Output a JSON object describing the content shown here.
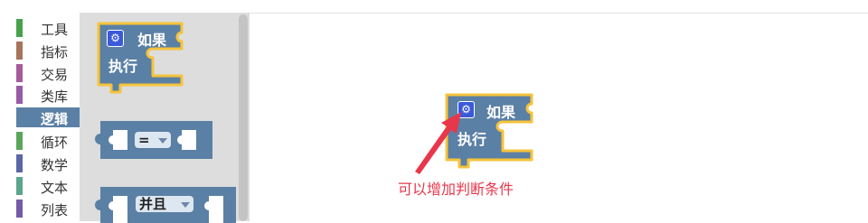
{
  "toolbox": {
    "categories": [
      {
        "label": "工具",
        "color": "#49a14b"
      },
      {
        "label": "指标",
        "color": "#a5745b"
      },
      {
        "label": "交易",
        "color": "#a55b99"
      },
      {
        "label": "类库",
        "color": "#995ba5"
      },
      {
        "label": "逻辑",
        "color": "#5b80a5",
        "selected": true
      },
      {
        "label": "循环",
        "color": "#5ba55b"
      },
      {
        "label": "数学",
        "color": "#5b67a5"
      },
      {
        "label": "文本",
        "color": "#5ba58c"
      },
      {
        "label": "列表",
        "color": "#745ba5"
      }
    ]
  },
  "flyout": {
    "if_block": {
      "if_label": "如果",
      "do_label": "执行",
      "settings_icon": "gear-icon"
    },
    "compare_block": {
      "operator": "="
    },
    "logic_block": {
      "operator": "并且"
    }
  },
  "workspace": {
    "if_block": {
      "if_label": "如果",
      "do_label": "执行",
      "settings_icon": "gear-icon"
    },
    "annotation": {
      "text": "可以增加判断条件",
      "color": "#e8374b"
    }
  },
  "colors": {
    "block_fill": "#5b80a5",
    "highlight": "#f5c33b",
    "flyout_bg": "#dddddd"
  }
}
